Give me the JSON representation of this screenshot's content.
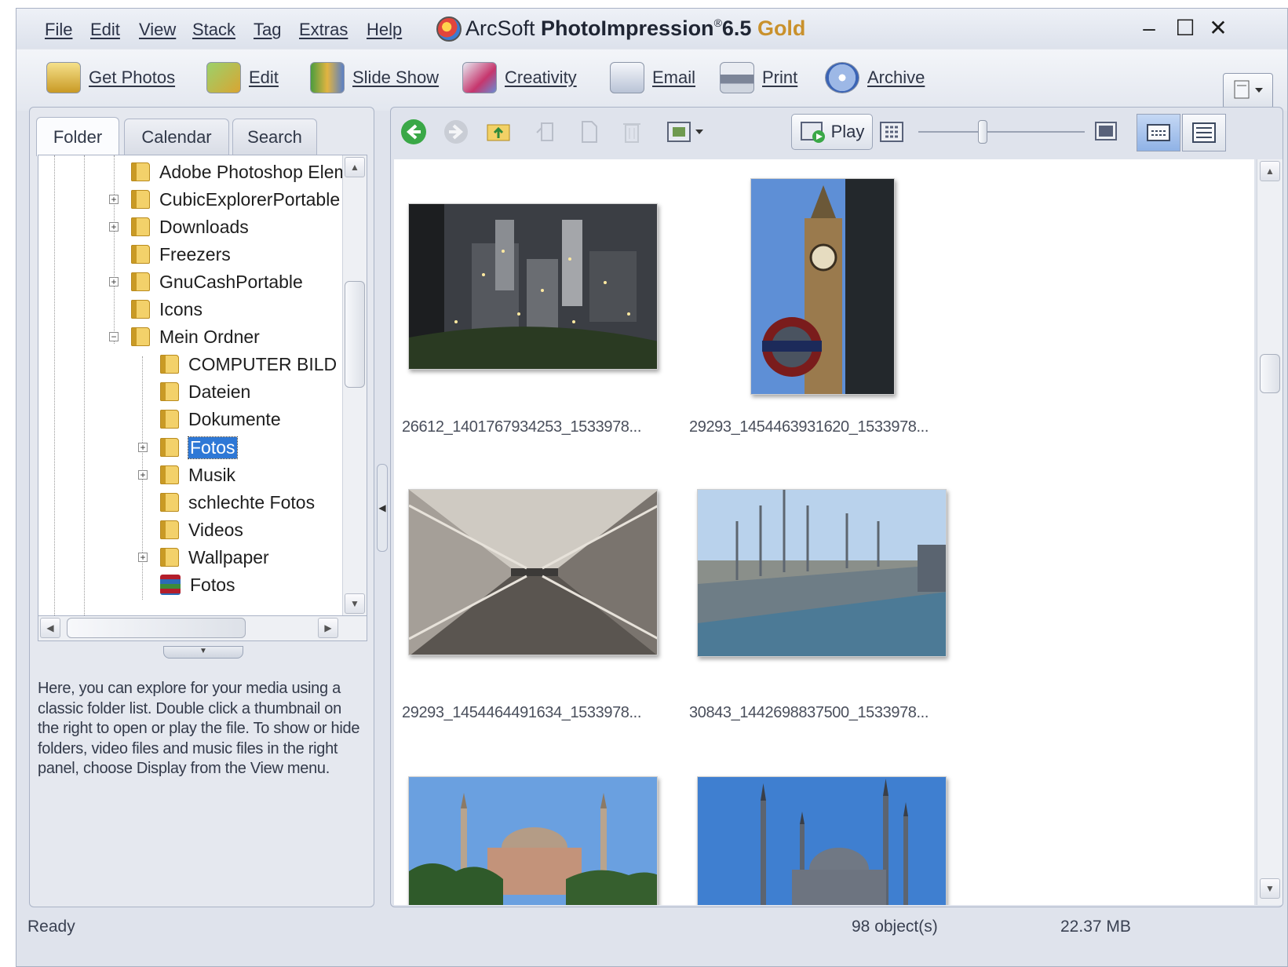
{
  "menu": [
    "File",
    "Edit",
    "View",
    "Stack",
    "Tag",
    "Extras",
    "Help"
  ],
  "title": {
    "brand": "ArcSoft ",
    "product": "PhotoImpression",
    "reg": "®",
    "version": "6.5 ",
    "edition": "Gold"
  },
  "window_controls": {
    "minimize": "–",
    "maximize": "☐",
    "close": "✕"
  },
  "toolbar": {
    "get_photos": "Get Photos",
    "edit": "Edit",
    "slide_show": "Slide Show",
    "creativity": "Creativity",
    "email": "Email",
    "print": "Print",
    "archive": "Archive"
  },
  "tabs": [
    "Folder",
    "Calendar",
    "Search"
  ],
  "tree": {
    "items": [
      "Adobe Photoshop Elem",
      "CubicExplorerPortable",
      "Downloads",
      "Freezers",
      "GnuCashPortable",
      "Icons",
      "Mein Ordner",
      "COMPUTER BILD L",
      "Dateien",
      "Dokumente",
      "Fotos",
      "Musik",
      "schlechte Fotos",
      "Videos",
      "Wallpaper",
      "Fotos"
    ],
    "selected": "Fotos"
  },
  "help_text": "Here, you can explore for your media using a classic folder list. Double click a thumbnail on the right to open or play the file. To show or hide folders, video files and music files in the right panel, choose Display from the View menu.",
  "viewer": {
    "play_label": "Play"
  },
  "thumbnails": [
    {
      "caption": "26612_1401767934253_1533978...",
      "subject": "city skyline at night"
    },
    {
      "caption": "29293_1454463931620_1533978...",
      "subject": "Big Ben clock tower"
    },
    {
      "caption": "29293_1454464491634_1533978...",
      "subject": "escalator tunnel"
    },
    {
      "caption": "30843_1442698837500_1533978...",
      "subject": "bridge with crowd"
    },
    {
      "caption": "",
      "subject": "Hagia Sophia"
    },
    {
      "caption": "",
      "subject": "Blue Mosque"
    }
  ],
  "status": {
    "state": "Ready",
    "objects": "98 object(s)",
    "size": "22.37 MB"
  },
  "colors": {
    "chrome_bg": "#dfe3ec",
    "selection": "#2e78d6",
    "title_gold": "#c9912c",
    "nav_green": "#3aa847"
  }
}
